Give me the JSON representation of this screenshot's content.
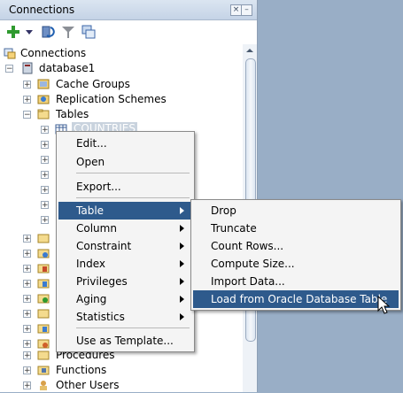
{
  "panel": {
    "title": "Connections"
  },
  "tree": {
    "root": "Connections",
    "db": "database1",
    "cache_groups": "Cache Groups",
    "replication": "Replication Schemes",
    "tables": "Tables",
    "countries": "COUNTRIES",
    "procedures": "Procedures",
    "functions": "Functions",
    "other_users": "Other Users"
  },
  "context_menu": {
    "edit": "Edit...",
    "open": "Open",
    "export": "Export...",
    "table": "Table",
    "column": "Column",
    "constraint": "Constraint",
    "index": "Index",
    "privileges": "Privileges",
    "aging": "Aging",
    "statistics": "Statistics",
    "use_as_template": "Use as Template..."
  },
  "submenu": {
    "drop": "Drop",
    "truncate": "Truncate",
    "count_rows": "Count Rows...",
    "compute_size": "Compute Size...",
    "import_data": "Import Data...",
    "load_from_oracle": "Load from Oracle Database Table"
  },
  "colors": {
    "selection": "#2e5a8c",
    "desktop": "#99aec6"
  }
}
